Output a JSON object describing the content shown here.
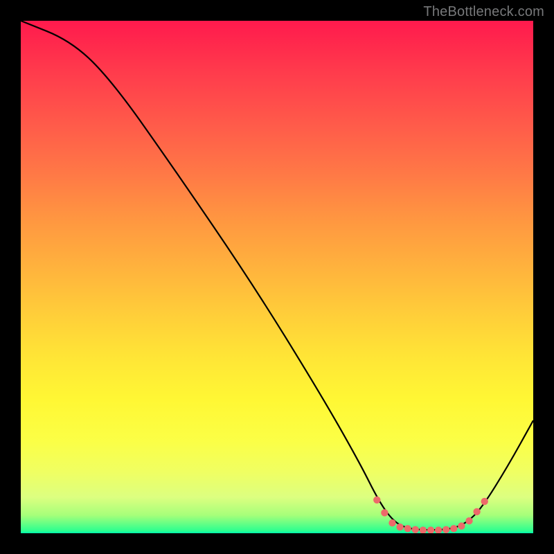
{
  "watermark": "TheBottleneck.com",
  "chart_data": {
    "type": "line",
    "title": "",
    "xlabel": "",
    "ylabel": "",
    "xlim": [
      0,
      100
    ],
    "ylim": [
      0,
      100
    ],
    "curve": [
      {
        "x": 0,
        "y": 100
      },
      {
        "x": 10,
        "y": 96
      },
      {
        "x": 18,
        "y": 88
      },
      {
        "x": 30,
        "y": 71
      },
      {
        "x": 45,
        "y": 49
      },
      {
        "x": 58,
        "y": 28
      },
      {
        "x": 66,
        "y": 14
      },
      {
        "x": 70,
        "y": 6
      },
      {
        "x": 73,
        "y": 2
      },
      {
        "x": 76,
        "y": 0.8
      },
      {
        "x": 80,
        "y": 0.6
      },
      {
        "x": 84,
        "y": 0.8
      },
      {
        "x": 87,
        "y": 2
      },
      {
        "x": 90,
        "y": 5
      },
      {
        "x": 95,
        "y": 13
      },
      {
        "x": 100,
        "y": 22
      }
    ],
    "markers": [
      {
        "x": 69.5,
        "y": 6.5
      },
      {
        "x": 71,
        "y": 4.0
      },
      {
        "x": 72.5,
        "y": 2.0
      },
      {
        "x": 74,
        "y": 1.2
      },
      {
        "x": 75.5,
        "y": 0.9
      },
      {
        "x": 77,
        "y": 0.7
      },
      {
        "x": 78.5,
        "y": 0.6
      },
      {
        "x": 80,
        "y": 0.6
      },
      {
        "x": 81.5,
        "y": 0.6
      },
      {
        "x": 83,
        "y": 0.7
      },
      {
        "x": 84.5,
        "y": 0.9
      },
      {
        "x": 86,
        "y": 1.4
      },
      {
        "x": 87.5,
        "y": 2.4
      },
      {
        "x": 89,
        "y": 4.2
      },
      {
        "x": 90.5,
        "y": 6.2
      }
    ],
    "marker_color": "#ed6a6a",
    "line_color": "#000000"
  }
}
